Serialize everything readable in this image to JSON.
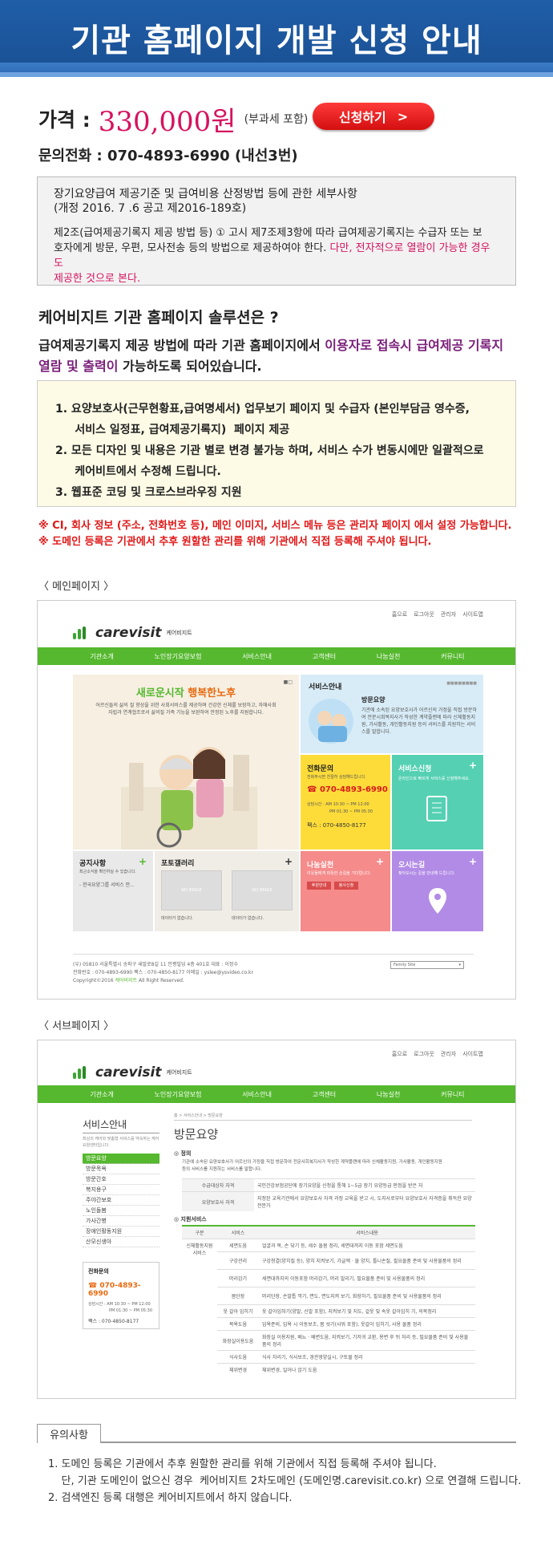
{
  "banner": {
    "title": "기관 홈페이지 개발 신청 안내"
  },
  "price": {
    "label": "가격 :",
    "value": "330,000원",
    "note": "(부과세 포함)"
  },
  "apply": {
    "label": "신청하기",
    "arrow": ">"
  },
  "phone": {
    "text": "문의전화 : 070-4893-6990 (내선3번)"
  },
  "regulation": {
    "title1": "장기요양급여 제공기준 및 급여비용 산정방법 등에 관한 세부사항",
    "title2": "(개정 2016. 7 .6  공고  제2016-189호)",
    "body1": "제2조(급여제공기록지 제공 방법 등) ① 고시 제7조제3항에 따라  급여제공기록지는 수급자 또는 보",
    "body2": "호자에게 방문, 우편, 모사전송 등의 방법으로 제공하여야 한다.",
    "body2_red": " 다만, 전자적으로 열람이 가능한 경우도",
    "body3_red": "제공한 것으로 본다."
  },
  "solution": {
    "title": "케어비지트 기관 홈페이지 솔루션은 ?",
    "desc1": "급여제공기록지 제공 방법에 따라 기관 홈페이지에서",
    "desc1_hl": " 이용자로 접속시 급여제공 기록지",
    "desc2_hl": "열람 및 출력이",
    "desc2": " 가능하도록  되어있습니다."
  },
  "features": [
    "1.  요양보호사(근무현황표,급여명세서)  업무보기 페이지  및  수급자 (본인부담금 영수증,",
    "     서비스 일정표, 급여제공기록지)  페이지 제공",
    "2. 모든 디자인 및 내용은  기관 별로 변경 불가능 하며, 서비스 수가 변동시에만  일괄적으로",
    "     케어비트에서 수정해 드립니다.",
    "3. 웹표준 코딩 및 크로스브라우징 지원"
  ],
  "notices": [
    "※ CI,  회사 정보 (주소, 전화번호 등), 메인 이미지, 서비스 메뉴 등은 관리자 페이지 에서  설정 가능합니다.",
    "※ 도메인 등록은 기관에서 추후 원할한 관리를 위해 기관에서 직접 등록해 주셔야 됩니다."
  ],
  "main_page": {
    "section_label": "〈 메인페이지 〉",
    "topnav": [
      "홈으로",
      "로그아웃",
      "관리자",
      "사이트맵"
    ],
    "logo": "carevisit",
    "logo_kr": "케어비지트",
    "gnav": [
      "기관소개",
      "노인장기요양보험",
      "서비스안내",
      "고객센터",
      "나눔실천",
      "커뮤니티"
    ],
    "hero_title": "새로운시작 ",
    "hero_title_hl": "행복한노후",
    "hero_text1": "어르신들의 삶의 질 향상을 위한 사회서비스를 제공하며 건강한 신체를 보장하고, 자애사회",
    "hero_text2": "자립과 연계협조로서 삶의질 가족 기능을 보완하여 안정된 노후를 지원합니다.",
    "svc_title": "서비스안내",
    "svc_sub": "방문요양",
    "svc_text": "기관에 소속된 요양보호사가 어르신의 가정을 직접 방문하여 전문시회복지사가 작성한 계약플랜에 따라 신체활동지원, 가사활동, 개인활동지원 등의 서비스를 지원하는 서비스를 말합니다.",
    "call_title": "전화문의",
    "call_sub": "전화주시면 친절히 상담해드립니다.",
    "call_num": "070-4893-6990",
    "call_hours1": "상담시간 : AM 10:30 ~ PM 12:00",
    "call_hours2": "PM 01:30 ~ PM 05:30",
    "call_fax": "팩스 : 070-4850-8177",
    "apply_title": "서비스신청",
    "apply_text": "온라인으로 빠르게 서비스를 신청해주세요.",
    "notice_title": "공지사항",
    "notice_text1": "최근소식을 확인하실 수 있습니다.",
    "notice_text2": "- 한국요양그룹 서비스 안...",
    "gallery_title": "포토갤러리",
    "noimage": "NO IMAGE",
    "nodata": "데이터가 없습니다.",
    "share_title": "나눔실천",
    "share_text": "이웃들에게 따뜻한 손길을 기다립니다.",
    "share_btn1": "후원안내",
    "share_btn2": "봉사신청",
    "map_title": "오시는길",
    "map_text": "찾아오시는 길을 안내해 드립니다.",
    "footer1": "(우) 05810   서울특별시 송파구 새말로8길 11 안평빌딩 4층 401호     대표 : 이정수",
    "footer2": "전화번호 : 070-4893-6990      팩스 : 070-4850-8177         이메일 : yslee@ysvideo.co.kr",
    "footer3": "Copyright©2016 ",
    "footer3_hl": "케어비지트",
    "footer3b": " All Right Reserved.",
    "family_site": "Family Site"
  },
  "sub_page": {
    "section_label": "〈 서브페이지 〉",
    "side_title": "서비스안내",
    "side_desc": "최상의 케어와 맞춤형 서비스를 약속하는 케어 요양센터입니다.",
    "menu": [
      "방문요양",
      "방문목욕",
      "방문간호",
      "복지용구",
      "주야간보호",
      "노인돌봄",
      "가사간병",
      "장애인활동지원",
      "산모신생아"
    ],
    "call_title": "전화문의",
    "call_num": "070-4893-6990",
    "call_hours1": "상담시간 : AM 10:30 ~ PM 12:00",
    "call_hours2": "PM 01:30 ~ PM 05:30",
    "call_fax": "팩스 : 070-4850-8177",
    "breadcrumb": "홈 > 서비스안내 > 방문요양",
    "page_title": "방문요양",
    "def_title": "정의",
    "def_text1": "기관에 소속된 요양보호사가 어르신의 가정을 직접 방문하여 전문사회복지사가 작성한 계약플랜에 따라 신체활동지원, 가사활동, 개인활동지원",
    "def_text2": "등의 서비스를 지원하는 서비스를 말합니다.",
    "qual_rows": [
      [
        "수급대상자 자격",
        "국민건강보험공단에 장기요양을 신청을 통해 1~5급 장기 요양등급 판정을 받은 자"
      ],
      [
        "요양보호사 자격",
        "지정된 교육기관에서 요양보호사 자격 과정 교육을 받고 시, 도지사로부터 요양보호사 자격증을 취득한 요양 전문가"
      ]
    ],
    "support_title": "지원서비스",
    "table_head": [
      "구분",
      "서비스",
      "서비스내용"
    ],
    "table_cat": "신체활동지원 서비스",
    "table_rows": [
      [
        "세면도움",
        "얼굴과 목, 손 닦기 등, 세수 돌봄 정리, 세면대까지 이동 포함 세면도움"
      ],
      [
        "구강관리",
        "구강청결(양치질 등), 양치 지켜보기, 가글액 · 물 양치, 틀니손질, 필요물품 준비 및 사용물품의 정리"
      ],
      [
        "머리감기",
        "세면대까지의 이동포함 머리감기, 머리 말리기, 필요물품 준비 및 사용물품의 정리"
      ],
      [
        "몸단장",
        "머리단장, 손발톱 깍기, 면도, 면도지켜 보기, 화장하기, 필요물품 준비 및 사용물품의 정리"
      ],
      [
        "옷 갈아 입히기",
        "옷 갈아입혀기(양말, 신발 포함), 지켜보기 및 지도, 겉옷 및 속옷 갈아입히 기, 의복정리"
      ],
      [
        "목욕도움",
        "입욕준비, 입욕 시 이동보조, 몸 씻기(샤워 포함), 옷갈아 입히기, 사용 물품 정리"
      ],
      [
        "화장실이용도움",
        "화장실 이용지원, 배뇨 · 배변도움, 지켜보기, 기저귀 교환, 용변 후 뒤 처리 등, 필요물품 준비 및 사용물품의 정리"
      ],
      [
        "식사도움",
        "식사 차리기, 식사보조, 경관영양실시, 구토물 정리"
      ],
      [
        "체위변경",
        "체위변경, 일어나 앉기 도움"
      ]
    ]
  },
  "caution": {
    "tab": "유의사항",
    "items": [
      "1. 도메인 등록은 기관에서 추후 원할한 관리를 위해 기관에서 직접 등록해 주셔야 됩니다.",
      "    단, 기관 도메인이 없으신 경우  케어비지트 2차도메인 (도메인명.carevisit.co.kr) 으로 연결해 드립니다.",
      "2. 검색엔진 등록 대행은 케어비지트에서 하지 않습니다."
    ]
  },
  "colors": {
    "banner": "#1f5ea8",
    "price": "#d6125f",
    "accent_green": "#55b82e",
    "apply_btn": "#e81c1c"
  }
}
